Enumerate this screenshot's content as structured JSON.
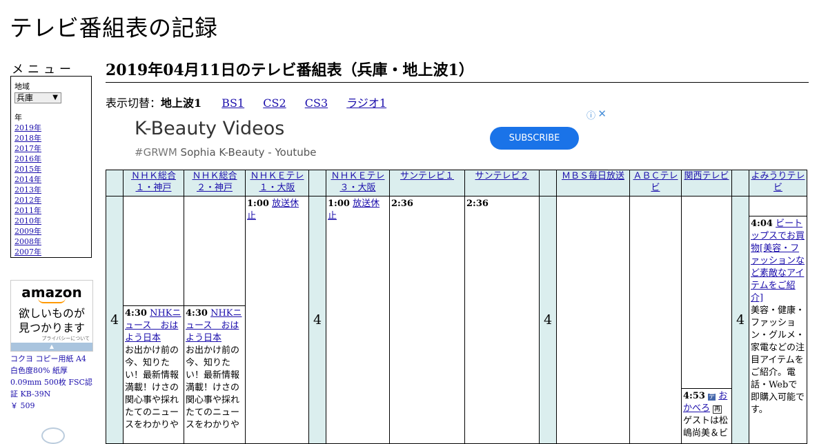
{
  "site_title": "テレビ番組表の記録",
  "menu": {
    "heading": "メニュー",
    "region_label": "地域",
    "region_value": "兵庫",
    "year_label": "年",
    "years": [
      "2019年",
      "2018年",
      "2017年",
      "2016年",
      "2015年",
      "2014年",
      "2013年",
      "2012年",
      "2011年",
      "2010年",
      "2009年",
      "2008年",
      "2007年"
    ]
  },
  "amazon_ad": {
    "logo": "amazon",
    "tagline_1": "欲しいものが",
    "tagline_2": "見つかります",
    "privacy": "プライバシーについて",
    "product_text": "コクヨ コピー用紙 A4 白色度80% 紙厚 0.09mm 500枚 FSC認証 KB-39N",
    "price": "￥ 509"
  },
  "page_heading": "2019年04月11日のテレビ番組表（兵庫・地上波1）",
  "switch": {
    "label": "表示切替：",
    "current": "地上波1",
    "links": [
      "BS1",
      "CS2",
      "CS3",
      "ラジオ1"
    ]
  },
  "banner_ad": {
    "title": "K-Beauty Videos",
    "subtitle_hash": "#GRWM",
    "subtitle_rest": " Sophia K-Beauty - Youtube",
    "button": "SUBSCRIBE",
    "info_icon": "info-icon",
    "close_icon": "close-icon"
  },
  "schedule": {
    "hour": "4",
    "channels": [
      "ＮＨＫ総合１・神戸",
      "ＮＨＫ総合２・神戸",
      "ＮＨＫＥテレ１・大阪",
      "ＮＨＫＥテレ３・大阪",
      "サンテレビ１",
      "サンテレビ２",
      "ＭＢＳ毎日放送",
      "ＡＢＣテレビ",
      "関西テレビ",
      "よみうりテレビ"
    ],
    "programs": {
      "nhk1_time": "4:30",
      "nhk1_title": "NHKニュース　おはよう日本",
      "nhk1_desc": "お出かけ前の今、知りたい！最新情報満載！けさの関心事や採れたてのニュースをわかりや",
      "nhk2_time": "4:30",
      "nhk2_title": "NHKニュース　おはよう日本",
      "nhk2_desc": "お出かけ前の今、知りたい！最新情報満載！けさの関心事や採れたてのニュースをわかりや",
      "etv1_time": "1:00",
      "etv1_title": "放送休止",
      "etv3_time": "1:00",
      "etv3_title": "放送休止",
      "sun1_time": "2:36",
      "sun2_time": "2:36",
      "ktv_time": "4:53",
      "ktv_title_a": "お",
      "ktv_title_b": "かべろ",
      "ktv_desc": "ゲストは松嶋尚美＆ビ",
      "ytv_time": "4:04",
      "ytv_title": "ビートップスでお買物[美容・ファッションなど素敵なアイテムをご紹介]",
      "ytv_desc": "美容・健康・ファッション・グルメ・家電などの注目アイテムをご紹介。電話・Webで即購入可能です。"
    }
  }
}
